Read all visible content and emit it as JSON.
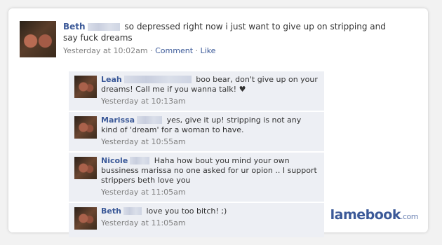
{
  "post": {
    "author": "Beth",
    "text": "so depressed right now i just want to give up on stripping and say fuck dreams",
    "time": "Yesterday at 10:02am",
    "separator": "·",
    "comment_link": "Comment",
    "like_link": "Like"
  },
  "comments": [
    {
      "author": "Leah",
      "text": "boo bear, don't give up on your dreams! Call me if you wanna talk! ♥",
      "time": "Yesterday at 10:13am"
    },
    {
      "author": "Marissa",
      "text": "yes, give it up! stripping is not any kind of 'dream' for a woman to have.",
      "time": "Yesterday at 10:55am"
    },
    {
      "author": "Nicole",
      "text": "Haha how bout you mind your own bussiness marissa no one asked for ur opion .. I support strippers beth love you",
      "time": "Yesterday at 11:05am"
    },
    {
      "author": "Beth",
      "text": "love you too bitch! ;)",
      "time": "Yesterday at 11:05am"
    }
  ],
  "brand": {
    "name": "lamebook",
    "tld": ".com"
  }
}
